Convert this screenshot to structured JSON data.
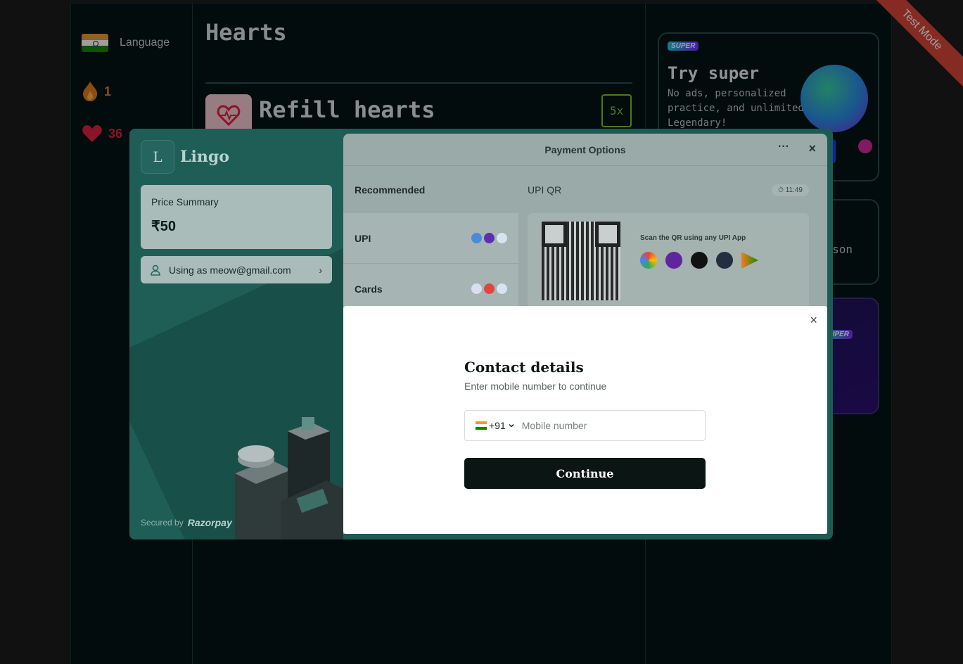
{
  "app": {
    "language_label": "Language",
    "streak_count": "1",
    "hearts_count": "36",
    "hearts_title": "Hearts",
    "refill_title": "Refill hearts",
    "refill_cost": "5x"
  },
  "sidebar": {
    "super_badge": "SUPER",
    "super_title": "Try super",
    "super_desc": "No ads, personalized practice, and unlimited Legendary!",
    "quest_text": "son",
    "promo_badge": "SUPER"
  },
  "ribbon": {
    "label": "Test Mode"
  },
  "checkout": {
    "logo_letter": "L",
    "merchant_name": "Lingo",
    "price_label": "Price Summary",
    "price_value": "₹50",
    "user_label": "Using as meow@gmail.com",
    "secured_label": "Secured by",
    "secured_brand": "Razorpay",
    "header_title": "Payment Options",
    "methods_heading": "Recommended",
    "methods": [
      {
        "label": "UPI"
      },
      {
        "label": "Cards"
      }
    ],
    "qr_title": "UPI QR",
    "qr_timer": "11:49",
    "qr_scan_text": "Scan the QR using any UPI App"
  },
  "contact_modal": {
    "title": "Contact details",
    "subtitle": "Enter mobile number to continue",
    "country_code": "+91",
    "phone_placeholder": "Mobile number",
    "phone_value": "",
    "continue_label": "Continue"
  },
  "colors": {
    "app_bg": "#041416",
    "checkout_left": "#1f5e57",
    "continue_button": "#0b1614",
    "ribbon": "#d8453b",
    "refill_accent": "#79c22e"
  }
}
